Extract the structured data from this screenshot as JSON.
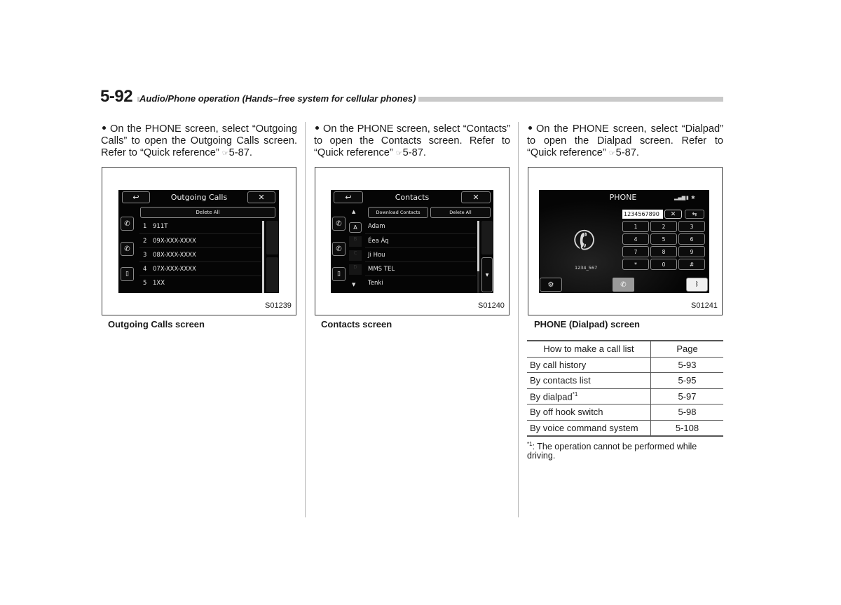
{
  "header": {
    "page_number": "5-92",
    "title": "Audio/Phone operation (Hands–free system for cellular phones)"
  },
  "columns": [
    {
      "paragraph": {
        "text": "On the PHONE screen, select “Outgoing Calls” to open the Outgoing Calls screen. Refer to “Quick reference”",
        "ref_icon": "reference-hand-icon",
        "ref_page": "5-87."
      },
      "figure_code": "S01239",
      "caption": "Outgoing Calls screen",
      "screen": {
        "title": "Outgoing Calls",
        "back_icon": "back-arrow-icon",
        "close_icon": "close-icon",
        "delete_all_label": "Delete All",
        "side_icons": [
          "incoming-call-icon",
          "outgoing-call-icon",
          "phone-device-icon"
        ],
        "rows": [
          {
            "index": "1",
            "value": "911T"
          },
          {
            "index": "2",
            "value": "09X-XXX-XXXX"
          },
          {
            "index": "3",
            "value": "08X-XXX-XXXX"
          },
          {
            "index": "4",
            "value": "07X-XXX-XXXX"
          },
          {
            "index": "5",
            "value": "1XX"
          }
        ]
      }
    },
    {
      "paragraph": {
        "text": "On the PHONE screen, select “Contacts” to open the Contacts screen. Refer to “Quick reference”",
        "ref_icon": "reference-hand-icon",
        "ref_page": "5-87."
      },
      "figure_code": "S01240",
      "caption": "Contacts screen",
      "screen": {
        "title": "Contacts",
        "download_label": "Download Contacts",
        "delete_all_label": "Delete All",
        "alphabet": [
          "A",
          "B",
          "C",
          "D"
        ],
        "rows": [
          "Adam",
          "Éea Áq",
          "Ji Hou",
          "MMS TEL",
          "Tenki"
        ]
      }
    },
    {
      "paragraph": {
        "text": "On the PHONE screen, select “Dialpad” to open the Dialpad screen. Refer to “Quick reference”",
        "ref_icon": "reference-hand-icon",
        "ref_page": "5-87."
      },
      "figure_code": "S01241",
      "caption": "PHONE (Dialpad) screen",
      "screen": {
        "title": "PHONE",
        "input_value": "1234567890",
        "contact_label": "1234_567",
        "keys": [
          "1",
          "2",
          "3",
          "4",
          "5",
          "6",
          "7",
          "8",
          "9",
          "*",
          "0",
          "#"
        ]
      },
      "table": {
        "headers": [
          "How to make a call list",
          "Page"
        ],
        "rows": [
          {
            "method": "By call history",
            "page": "5-93",
            "note": ""
          },
          {
            "method": "By contacts list",
            "page": "5-95",
            "note": ""
          },
          {
            "method": "By dialpad",
            "page": "5-97",
            "note": "*1"
          },
          {
            "method": "By off hook switch",
            "page": "5-98",
            "note": ""
          },
          {
            "method": "By voice command system",
            "page": "5-108",
            "note": ""
          }
        ]
      },
      "footnote": {
        "marker": "*1",
        "text": ": The operation cannot be performed while driving."
      }
    }
  ]
}
